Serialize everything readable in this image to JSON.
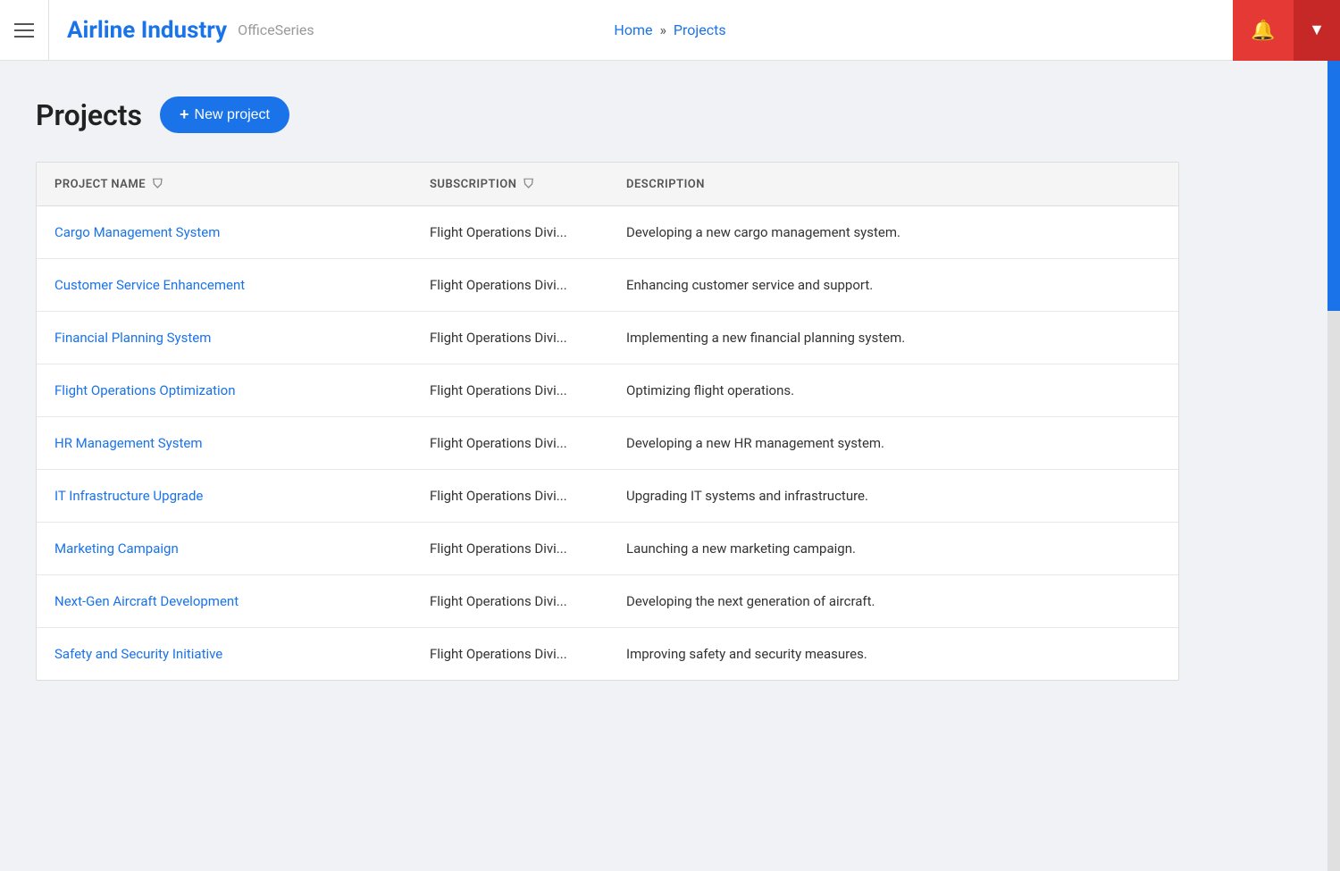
{
  "header": {
    "menu_label": "Menu",
    "title": "Airline Industry",
    "subtitle": "OfficeSeries",
    "breadcrumb": {
      "home": "Home",
      "separator": "»",
      "current": "Projects"
    },
    "bell_icon": "🔔",
    "dropdown_icon": "▼"
  },
  "page": {
    "title": "Projects",
    "new_project_button": "+ New project"
  },
  "table": {
    "columns": [
      {
        "id": "project_name",
        "label": "PROJECT NAME",
        "filterable": true
      },
      {
        "id": "subscription",
        "label": "SUBSCRIPTION",
        "filterable": true
      },
      {
        "id": "description",
        "label": "DESCRIPTION",
        "filterable": false
      }
    ],
    "rows": [
      {
        "project_name": "Cargo Management System",
        "subscription": "Flight Operations Divi...",
        "description": "Developing a new cargo management system."
      },
      {
        "project_name": "Customer Service Enhancement",
        "subscription": "Flight Operations Divi...",
        "description": "Enhancing customer service and support."
      },
      {
        "project_name": "Financial Planning System",
        "subscription": "Flight Operations Divi...",
        "description": "Implementing a new financial planning system."
      },
      {
        "project_name": "Flight Operations Optimization",
        "subscription": "Flight Operations Divi...",
        "description": "Optimizing flight operations."
      },
      {
        "project_name": "HR Management System",
        "subscription": "Flight Operations Divi...",
        "description": "Developing a new HR management system."
      },
      {
        "project_name": "IT Infrastructure Upgrade",
        "subscription": "Flight Operations Divi...",
        "description": "Upgrading IT systems and infrastructure."
      },
      {
        "project_name": "Marketing Campaign",
        "subscription": "Flight Operations Divi...",
        "description": "Launching a new marketing campaign."
      },
      {
        "project_name": "Next-Gen Aircraft Development",
        "subscription": "Flight Operations Divi...",
        "description": "Developing the next generation of aircraft."
      },
      {
        "project_name": "Safety and Security Initiative",
        "subscription": "Flight Operations Divi...",
        "description": "Improving safety and security measures."
      }
    ]
  }
}
